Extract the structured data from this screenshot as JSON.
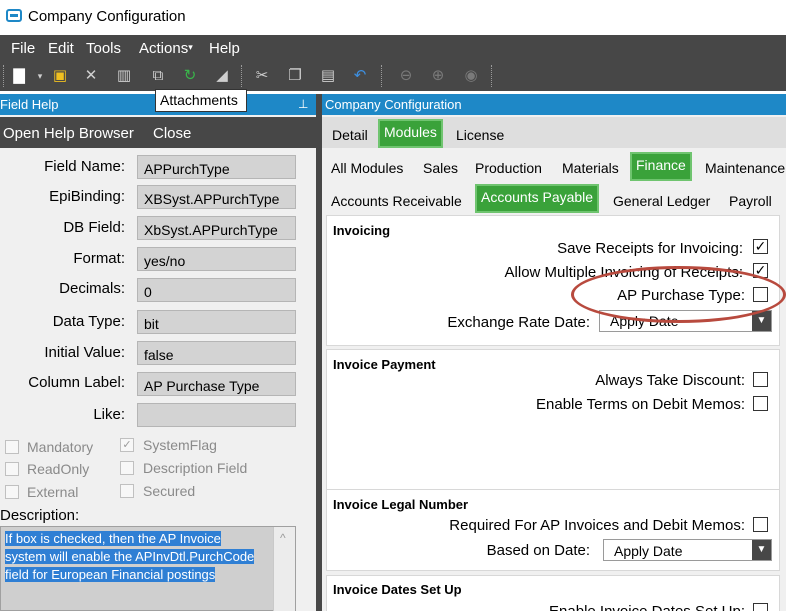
{
  "window": {
    "title": "Company Configuration"
  },
  "menu": [
    "File",
    "Edit",
    "Tools",
    "Actions",
    "Help"
  ],
  "toolbar": {
    "tooltip": "Attachments",
    "icons": [
      "new-icon",
      "save-icon",
      "delete-icon",
      "book-icon",
      "attach-icon",
      "refresh-icon",
      "eraser-icon",
      "cut-icon",
      "copy-icon",
      "paste-icon",
      "undo-icon",
      "back-icon",
      "forward-icon",
      "stop-icon"
    ]
  },
  "field_help": {
    "header": "Field Help",
    "open_help_browser": "Open Help Browser",
    "close": "Close",
    "fields": [
      {
        "label": "Field Name:",
        "value": "APPurchType"
      },
      {
        "label": "EpiBinding:",
        "value": "XBSyst.APPurchType"
      },
      {
        "label": "DB Field:",
        "value": "XbSyst.APPurchType"
      },
      {
        "label": "Format:",
        "value": "yes/no"
      },
      {
        "label": "Decimals:",
        "value": "0"
      },
      {
        "label": "Data Type:",
        "value": "bit"
      },
      {
        "label": "Initial Value:",
        "value": "false"
      },
      {
        "label": "Column Label:",
        "value": "AP Purchase Type"
      },
      {
        "label": "Like:",
        "value": ""
      }
    ],
    "flags": [
      {
        "label": "Mandatory",
        "checked": false
      },
      {
        "label": "SystemFlag",
        "checked": true
      },
      {
        "label": "ReadOnly",
        "checked": false
      },
      {
        "label": "Description Field",
        "checked": false
      },
      {
        "label": "External",
        "checked": false
      },
      {
        "label": "Secured",
        "checked": false
      }
    ],
    "description_label": "Description:",
    "description_lines": [
      "If box is checked, then the AP Invoice",
      "system will enable the APInvDtl.PurchCode",
      "field for European Financial postings"
    ]
  },
  "config": {
    "header": "Company Configuration",
    "tabs_top": [
      "Detail",
      "Modules",
      "License"
    ],
    "tabs_modules": [
      "All Modules",
      "Sales",
      "Production",
      "Materials",
      "Finance",
      "Maintenance"
    ],
    "tabs_finance": [
      "Accounts Receivable",
      "Accounts Payable",
      "General Ledger",
      "Payroll"
    ],
    "invoicing": {
      "title": "Invoicing",
      "save_receipts": "Save Receipts for Invoicing:",
      "allow_multiple": "Allow Multiple Invoicing of Receipts:",
      "ap_purchase_type": "AP Purchase Type:",
      "exchange_rate_date": "Exchange Rate Date:",
      "exchange_rate_value": "Apply Date"
    },
    "invoice_payment": {
      "title": "Invoice Payment",
      "always_take_discount": "Always Take Discount:",
      "enable_terms": "Enable Terms on Debit Memos:"
    },
    "legal_number": {
      "title": "Invoice Legal Number",
      "required_for": "Required For AP Invoices and  Debit Memos:",
      "based_on_date": "Based on Date:",
      "based_on_value": "Apply Date"
    },
    "dates_setup": {
      "title": "Invoice Dates Set Up",
      "enable": "Enable Invoice Dates Set Up:"
    }
  }
}
